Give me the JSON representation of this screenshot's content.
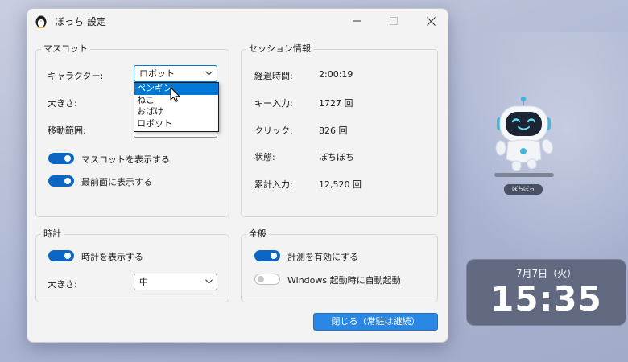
{
  "window": {
    "title": "ぼっち 設定",
    "icons": {
      "app": "penguin-icon",
      "minimize": "minimize-icon",
      "maximize": "maximize-icon",
      "close": "close-icon"
    }
  },
  "mascot_group": {
    "title": "マスコット",
    "character_label": "キャラクター:",
    "character_value": "ロボット",
    "character_options": [
      "ペンギン",
      "ねこ",
      "おばけ",
      "ロボット"
    ],
    "highlighted_option": "ペンギン",
    "size_label": "大きさ:",
    "range_label": "移動範囲:",
    "show_mascot_label": "マスコットを表示する",
    "show_mascot_on": true,
    "topmost_label": "最前面に表示する",
    "topmost_on": true
  },
  "session_group": {
    "title": "セッション情報",
    "rows": [
      {
        "label": "経過時間:",
        "value": "2:00:19"
      },
      {
        "label": "キー入力:",
        "value": "1727 回"
      },
      {
        "label": "クリック:",
        "value": "826 回"
      },
      {
        "label": "状態:",
        "value": "ぼちぼち"
      },
      {
        "label": "累計入力:",
        "value": "12,520 回"
      }
    ]
  },
  "clock_group": {
    "title": "時計",
    "show_clock_label": "時計を表示する",
    "show_clock_on": true,
    "size_label": "大きさ:",
    "size_value": "中"
  },
  "general_group": {
    "title": "全般",
    "enable_measure_label": "計測を有効にする",
    "enable_measure_on": true,
    "autostart_label": "Windows 起動時に自動起動",
    "autostart_on": false
  },
  "close_button": "閉じる（常駐は継続）",
  "mascot_widget": {
    "status_label": "ぼちぼち",
    "icon": "robot-mascot-icon"
  },
  "clock_widget": {
    "date": "7月7日（火）",
    "time": "15:35"
  },
  "colors": {
    "accent": "#0a66c2",
    "selection": "#0078d4",
    "button": "#2a87e3",
    "clock_bg": "#586076"
  }
}
